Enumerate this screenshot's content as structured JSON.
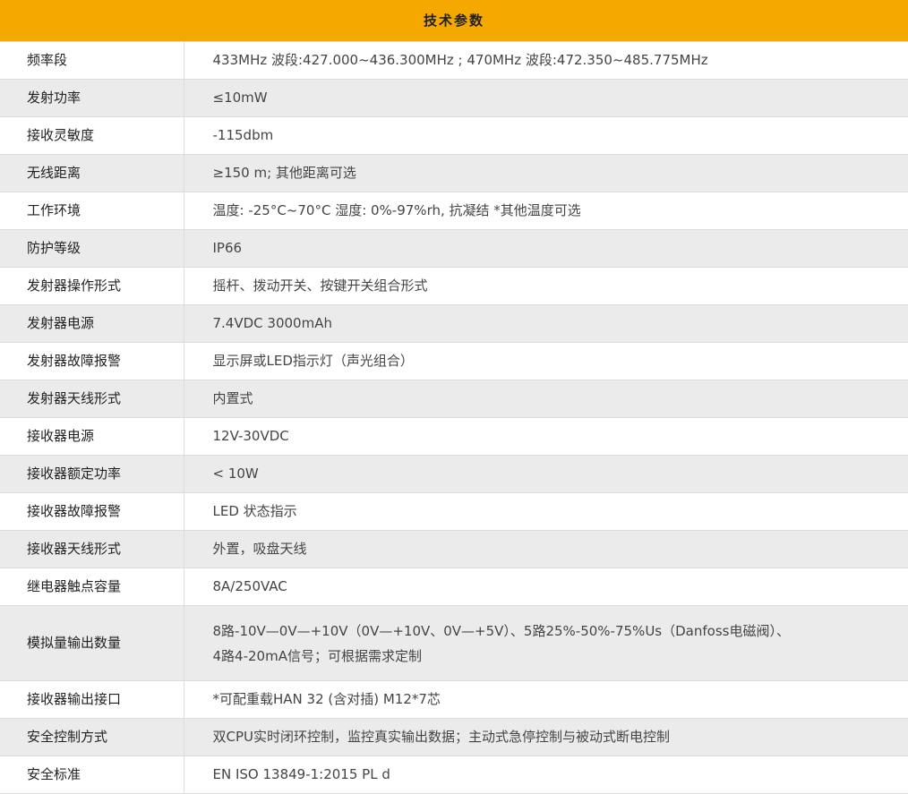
{
  "title": "技术参数",
  "rows": [
    {
      "label": "频率段",
      "value": "433MHz 波段:427.000~436.300MHz ; 470MHz 波段:472.350~485.775MHz"
    },
    {
      "label": "发射功率",
      "value": "≤10mW"
    },
    {
      "label": "接收灵敏度",
      "value": "-115dbm"
    },
    {
      "label": "无线距离",
      "value": "≥150 m;  其他距离可选"
    },
    {
      "label": "工作环境",
      "value": "温度: -25°C~70°C  湿度: 0%-97%rh, 抗凝结   *其他温度可选"
    },
    {
      "label": "防护等级",
      "value": "IP66"
    },
    {
      "label": "发射器操作形式",
      "value": "摇杆、拨动开关、按键开关组合形式"
    },
    {
      "label": "发射器电源",
      "value": "7.4VDC 3000mAh"
    },
    {
      "label": "发射器故障报警",
      "value": "显示屏或LED指示灯（声光组合）"
    },
    {
      "label": "发射器天线形式",
      "value": "内置式"
    },
    {
      "label": "接收器电源",
      "value": "12V-30VDC"
    },
    {
      "label": "接收器额定功率",
      "value": "< 10W"
    },
    {
      "label": "接收器故障报警",
      "value": "LED 状态指示"
    },
    {
      "label": "接收器天线形式",
      "value": "外置，吸盘天线"
    },
    {
      "label": "继电器触点容量",
      "value": "8A/250VAC"
    },
    {
      "label": "模拟量输出数量",
      "value_line1": "8路-10V—0V—+10V（0V—+10V、0V—+5V）、5路25%-50%-75%Us（Danfoss电磁阀）、",
      "value_line2": "4路4-20mA信号；可根据需求定制"
    },
    {
      "label": "接收器输出接口",
      "value": "*可配重载HAN 32 (含对插)  M12*7芯"
    },
    {
      "label": "安全控制方式",
      "value": "双CPU实时闭环控制，监控真实输出数据；主动式急停控制与被动式断电控制"
    },
    {
      "label": "安全标准",
      "value": "EN ISO 13849-1:2015 PL d"
    }
  ]
}
